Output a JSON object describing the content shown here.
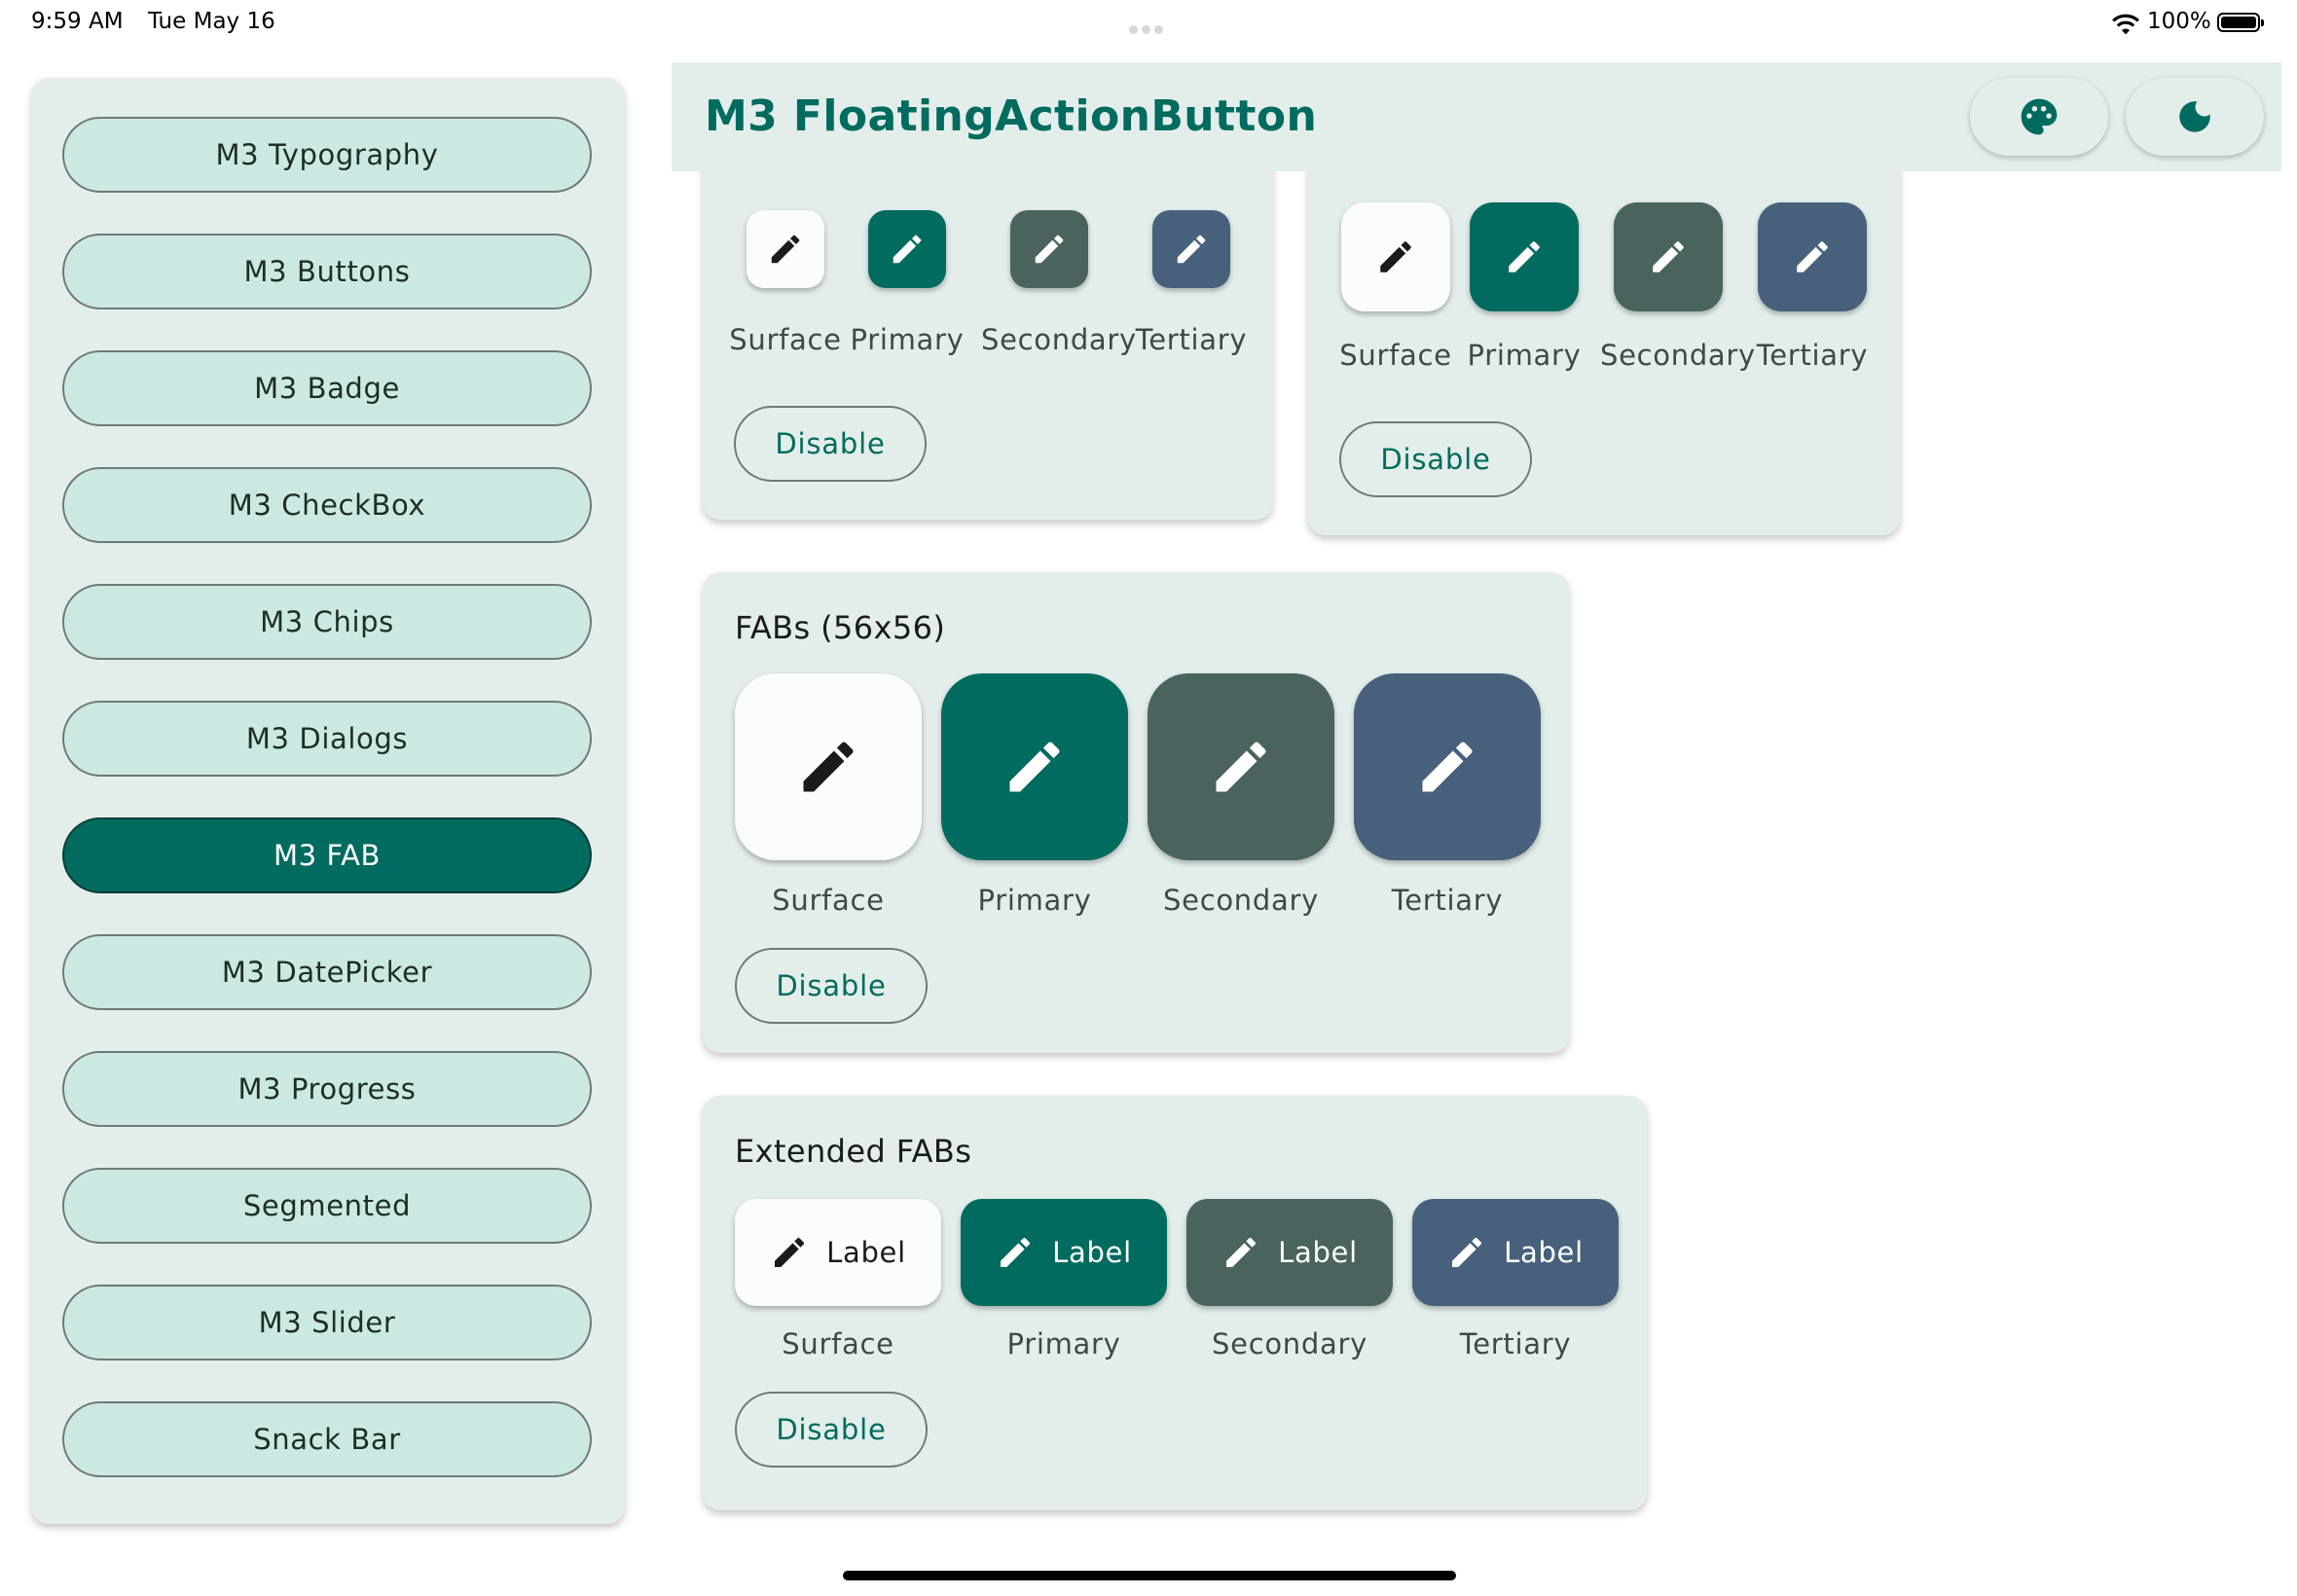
{
  "status_bar": {
    "time": "9:59 AM",
    "date": "Tue May 16",
    "battery": "100%"
  },
  "app_bar": {
    "title": "M3 FloatingActionButton",
    "actions": [
      {
        "icon": "palette-icon"
      },
      {
        "icon": "dark-mode-icon"
      }
    ]
  },
  "sidebar": {
    "items": [
      {
        "label": "M3 Typography",
        "active": false
      },
      {
        "label": "M3 Buttons",
        "active": false
      },
      {
        "label": "M3 Badge",
        "active": false
      },
      {
        "label": "M3 CheckBox",
        "active": false
      },
      {
        "label": "M3 Chips",
        "active": false
      },
      {
        "label": "M3 Dialogs",
        "active": false
      },
      {
        "label": "M3 FAB",
        "active": true
      },
      {
        "label": "M3 DatePicker",
        "active": false
      },
      {
        "label": "M3 Progress",
        "active": false
      },
      {
        "label": "Segmented",
        "active": false
      },
      {
        "label": "M3 Slider",
        "active": false
      },
      {
        "label": "Snack Bar",
        "active": false
      }
    ]
  },
  "cards": {
    "small": {
      "labels": [
        "Surface",
        "Primary",
        "Secondary",
        "Tertiary"
      ],
      "disable_label": "Disable"
    },
    "regular": {
      "labels": [
        "Surface",
        "Primary",
        "Secondary",
        "Tertiary"
      ],
      "disable_label": "Disable"
    },
    "large": {
      "title": "FABs (56x56)",
      "labels": [
        "Surface",
        "Primary",
        "Secondary",
        "Tertiary"
      ],
      "disable_label": "Disable"
    },
    "extended": {
      "title": "Extended FABs",
      "button_label": "Label",
      "labels": [
        "Surface",
        "Primary",
        "Secondary",
        "Tertiary"
      ],
      "disable_label": "Disable"
    }
  },
  "colors": {
    "primary": "#006b5e",
    "secondary": "#4a635e",
    "tertiary": "#47617c",
    "surface": "#fbfdfc",
    "container": "#e3eeeb"
  },
  "icons": {
    "fab_icon": "edit-pencil-icon"
  }
}
